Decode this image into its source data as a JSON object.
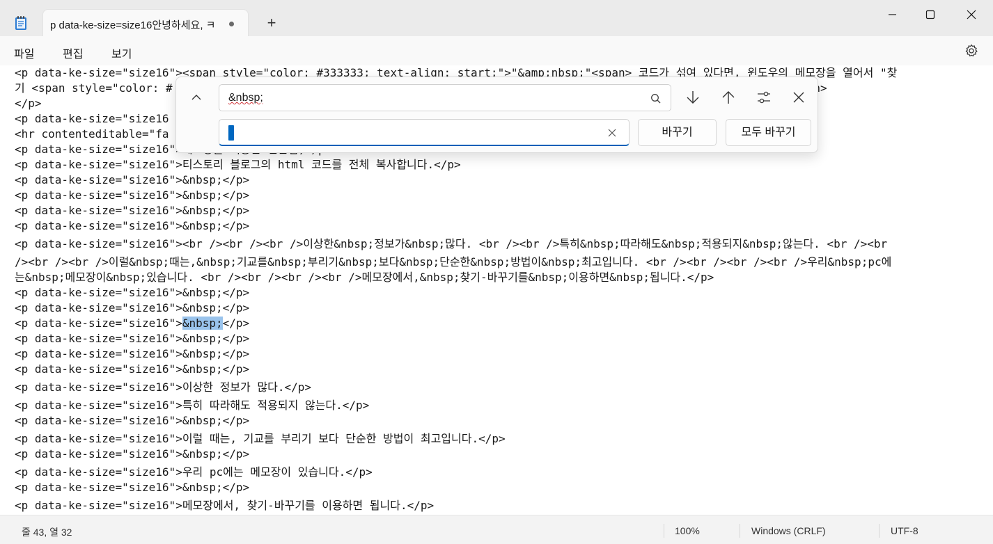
{
  "window": {
    "tab_title": "p data-ke-size=size16안녕하세요, ㅋ",
    "new_tab_symbol": "+"
  },
  "menu": {
    "file": "파일",
    "edit": "편집",
    "view": "보기"
  },
  "editor": {
    "lines": [
      "<p data-ke-size=\"size16\"><span style=\"color: #333333; text-align: start;\">\"&amp;nbsp;\"<span> 코드가 섞여 있다면, 윈도우의 메모장을 열어서 \"찾",
      "기 <span style=\"color: #                                                                              됩니다.</span></span>",
      "</p>",
      "<p data-ke-size=\"size16",
      "<hr contenteditable=\"fa",
      "<p data-ke-size=\"size16\">메모장을 이용한 변환법;</p>",
      "<p data-ke-size=\"size16\">티스토리 블로그의 html 코드를 전체 복사합니다.</p>",
      "<p data-ke-size=\"size16\">&nbsp;</p>",
      "<p data-ke-size=\"size16\">&nbsp;</p>",
      "<p data-ke-size=\"size16\">&nbsp;</p>",
      "<p data-ke-size=\"size16\">&nbsp;</p>",
      "<p data-ke-size=\"size16\"><br /><br /><br />이상한&nbsp;정보가&nbsp;많다. <br /><br />특히&nbsp;따라해도&nbsp;적용되지&nbsp;않는다. <br /><br",
      "/><br /><br />이럴&nbsp;때는,&nbsp;기교를&nbsp;부리기&nbsp;보다&nbsp;단순한&nbsp;방법이&nbsp;최고입니다. <br /><br /><br /><br />우리&nbsp;pc에",
      "는&nbsp;메모장이&nbsp;있습니다. <br /><br /><br /><br />메모장에서,&nbsp;찾기-바꾸기를&nbsp;이용하면&nbsp;됩니다.</p>",
      "<p data-ke-size=\"size16\">&nbsp;</p>",
      "<p data-ke-size=\"size16\">&nbsp;</p>",
      "<p data-ke-size=\"size16\">",
      "<p data-ke-size=\"size16\">&nbsp;</p>",
      "<p data-ke-size=\"size16\">&nbsp;</p>",
      "<p data-ke-size=\"size16\">&nbsp;</p>",
      "<p data-ke-size=\"size16\">이상한 정보가 많다.</p>",
      "<p data-ke-size=\"size16\">특히 따라해도 적용되지 않는다.</p>",
      "<p data-ke-size=\"size16\">&nbsp;</p>",
      "<p data-ke-size=\"size16\">이럴 때는, 기교를 부리기 보다 단순한 방법이 최고입니다.</p>",
      "<p data-ke-size=\"size16\">&nbsp;</p>",
      "<p data-ke-size=\"size16\">우리 pc에는 메모장이 있습니다.</p>",
      "<p data-ke-size=\"size16\">&nbsp;</p>",
      "<p data-ke-size=\"size16\">메모장에서, 찾기-바꾸기를 이용하면 됩니다.</p>"
    ],
    "highlighted_match": "&nbsp;",
    "highlighted_line_tail": "</p>"
  },
  "find_panel": {
    "find_value": "&nbsp;",
    "replace_value": "",
    "replace_button": "바꾸기",
    "replace_all_button": "모두 바꾸기"
  },
  "status": {
    "position": "줄 43, 열 32",
    "zoom": "100%",
    "line_ending": "Windows (CRLF)",
    "encoding": "UTF-8"
  },
  "colors": {
    "accent": "#005fb8",
    "highlight": "#99c3ec",
    "spell_error": "#d13438"
  }
}
